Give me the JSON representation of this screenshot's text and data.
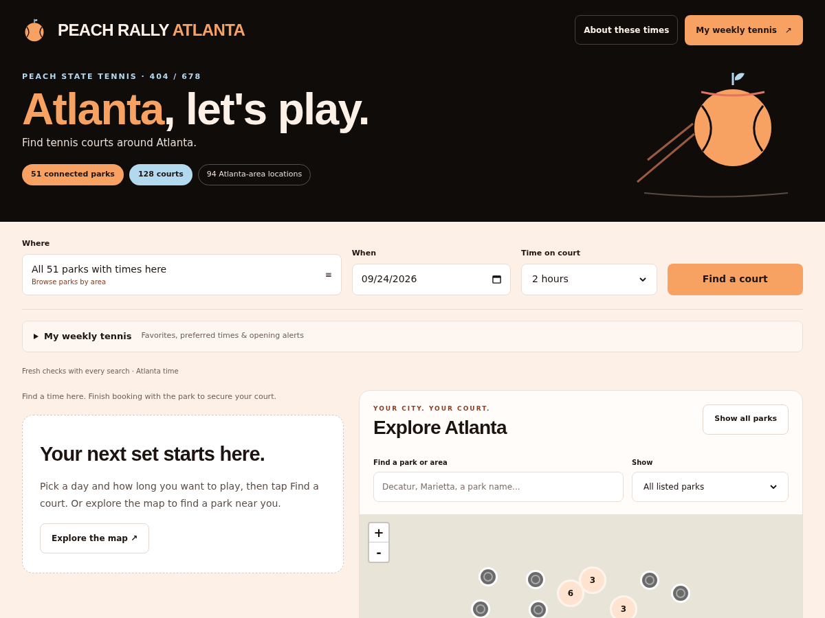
{
  "header": {
    "brand": {
      "name": "PEACH RALLY",
      "accent": "ATLANTA"
    },
    "buttons": [
      {
        "label": "About these times",
        "kind": "outline"
      },
      {
        "label": "My weekly tennis",
        "kind": "primary",
        "arrow": "↗"
      }
    ],
    "eyebrow": "PEACH STATE TENNIS · 404 / 678",
    "headline": {
      "accent": "Atlanta",
      "rest": ", let's play."
    },
    "subtitle": "Find tennis courts around Atlanta.",
    "pills": [
      {
        "label": "51 connected parks",
        "color": "#f7a262"
      },
      {
        "label": "128 courts",
        "color": "#b3d9ef"
      },
      {
        "label": "94 Atlanta-area locations",
        "color": "#100c0a"
      }
    ]
  },
  "search": {
    "where": {
      "label": "Where",
      "value": "All 51 parks with times here",
      "link": "Browse parks by area",
      "icon": "≡"
    },
    "when": {
      "label": "When",
      "value": "09/24/2026"
    },
    "duration": {
      "label": "Time on court",
      "value": "2 hours"
    },
    "submit": "Find a court"
  },
  "weekly": {
    "title": "My weekly tennis",
    "hint": "Favorites, preferred times & opening alerts",
    "expanded": false
  },
  "freshness": "Fresh checks with every search · Atlanta time",
  "booking_note": "Find a time here. Finish booking with the park to secure your court.",
  "empty_state": {
    "title": "Your next set starts here.",
    "body": "Pick a day and how long you want to play, then tap Find a court. Or explore the map to find a park near you.",
    "button": "Explore the map ↗"
  },
  "explore": {
    "eyebrow": "YOUR CITY. YOUR COURT.",
    "title": "Explore Atlanta",
    "button": "Show all parks",
    "search": {
      "label": "Find a park or area",
      "placeholder": "Decatur, Marietta, a park name..."
    },
    "filter": {
      "label": "Show",
      "value": "All listed parks"
    },
    "map": {
      "zoom_in": "+",
      "zoom_out": "-",
      "markers": [
        {
          "kind": "single"
        },
        {
          "kind": "single"
        },
        {
          "kind": "cluster",
          "count": "3"
        },
        {
          "kind": "cluster",
          "count": "6"
        },
        {
          "kind": "single"
        },
        {
          "kind": "single"
        },
        {
          "kind": "single"
        },
        {
          "kind": "single"
        },
        {
          "kind": "cluster",
          "count": "3"
        }
      ]
    }
  }
}
